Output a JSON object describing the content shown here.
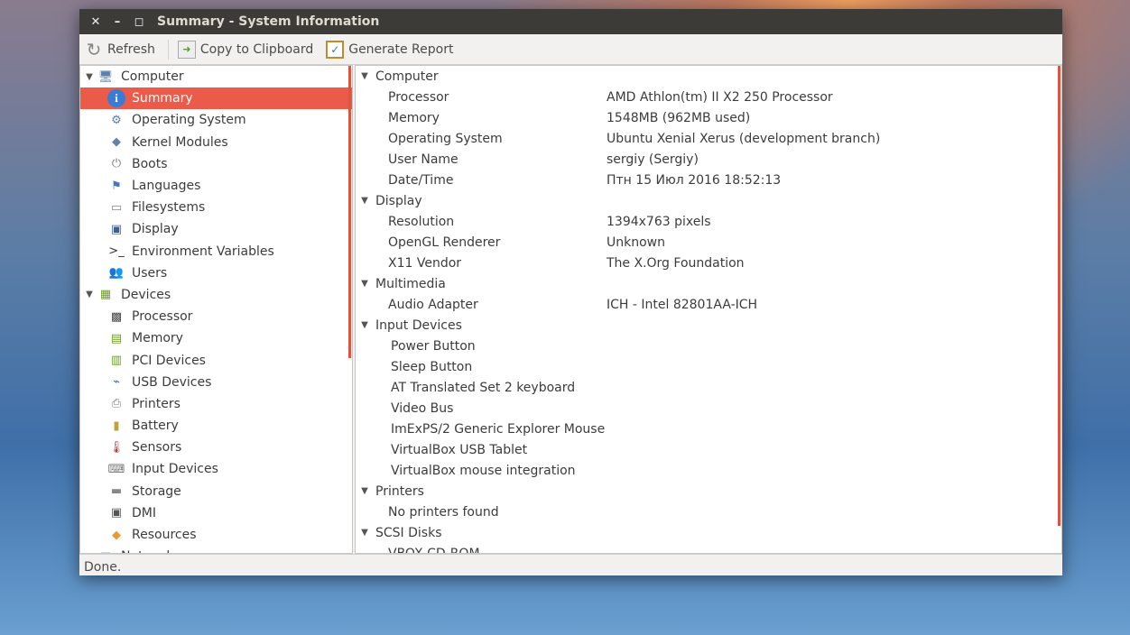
{
  "window": {
    "title": "Summary - System Information",
    "close": "✕",
    "minimize": "–",
    "maximize": "▫"
  },
  "toolbar": {
    "refresh": "Refresh",
    "copy": "Copy to Clipboard",
    "report": "Generate Report"
  },
  "tree": [
    {
      "label": "Computer",
      "level": 0,
      "icon": "computer-icon",
      "glyph": "🖥",
      "color": "#5a7fb0"
    },
    {
      "label": "Summary",
      "level": 1,
      "icon": "info-icon",
      "glyph": "i",
      "color": "#3a7bd5",
      "selected": true
    },
    {
      "label": "Operating System",
      "level": 1,
      "icon": "gear-icon",
      "glyph": "⚙",
      "color": "#5a7fb0"
    },
    {
      "label": "Kernel Modules",
      "level": 1,
      "icon": "module-icon",
      "glyph": "◆",
      "color": "#6a7fb0"
    },
    {
      "label": "Boots",
      "level": 1,
      "icon": "power-icon",
      "glyph": "⏻",
      "color": "#777"
    },
    {
      "label": "Languages",
      "level": 1,
      "icon": "flag-icon",
      "glyph": "⚑",
      "color": "#4a78c0"
    },
    {
      "label": "Filesystems",
      "level": 1,
      "icon": "drive-icon",
      "glyph": "▭",
      "color": "#888"
    },
    {
      "label": "Display",
      "level": 1,
      "icon": "monitor-icon",
      "glyph": "▣",
      "color": "#3a5f90"
    },
    {
      "label": "Environment Variables",
      "level": 1,
      "icon": "terminal-icon",
      "glyph": ">_",
      "color": "#333"
    },
    {
      "label": "Users",
      "level": 1,
      "icon": "users-icon",
      "glyph": "👥",
      "color": "#d08a30"
    },
    {
      "label": "Devices",
      "level": 0,
      "icon": "devices-icon",
      "glyph": "▦",
      "color": "#6aa020"
    },
    {
      "label": "Processor",
      "level": 1,
      "icon": "cpu-icon",
      "glyph": "▩",
      "color": "#444"
    },
    {
      "label": "Memory",
      "level": 1,
      "icon": "memory-icon",
      "glyph": "▤",
      "color": "#6aa020"
    },
    {
      "label": "PCI Devices",
      "level": 1,
      "icon": "pci-icon",
      "glyph": "▥",
      "color": "#6aa020"
    },
    {
      "label": "USB Devices",
      "level": 1,
      "icon": "usb-icon",
      "glyph": "⌁",
      "color": "#3a6fb0"
    },
    {
      "label": "Printers",
      "level": 1,
      "icon": "printer-icon",
      "glyph": "⎙",
      "color": "#777"
    },
    {
      "label": "Battery",
      "level": 1,
      "icon": "battery-icon",
      "glyph": "▮",
      "color": "#c0a040"
    },
    {
      "label": "Sensors",
      "level": 1,
      "icon": "thermometer-icon",
      "glyph": "🌡",
      "color": "#c03030"
    },
    {
      "label": "Input Devices",
      "level": 1,
      "icon": "input-icon",
      "glyph": "⌨",
      "color": "#777"
    },
    {
      "label": "Storage",
      "level": 1,
      "icon": "storage-icon",
      "glyph": "▬",
      "color": "#888"
    },
    {
      "label": "DMI",
      "level": 1,
      "icon": "dmi-icon",
      "glyph": "▣",
      "color": "#555"
    },
    {
      "label": "Resources",
      "level": 1,
      "icon": "resources-icon",
      "glyph": "◆",
      "color": "#e89a30"
    },
    {
      "label": "Network",
      "level": 0,
      "icon": "network-icon",
      "glyph": "▣",
      "color": "#3a5f90"
    }
  ],
  "details": [
    {
      "type": "section",
      "label": "Computer"
    },
    {
      "type": "kv",
      "key": "Processor",
      "value": "AMD Athlon(tm) II X2 250 Processor"
    },
    {
      "type": "kv",
      "key": "Memory",
      "value": "1548MB (962MB used)"
    },
    {
      "type": "kv",
      "key": "Operating System",
      "value": "Ubuntu Xenial Xerus (development branch)"
    },
    {
      "type": "kv",
      "key": "User Name",
      "value": "sergiy (Sergiy)"
    },
    {
      "type": "kv",
      "key": "Date/Time",
      "value": "Птн 15 Июл 2016 18:52:13"
    },
    {
      "type": "section",
      "label": "Display"
    },
    {
      "type": "kv",
      "key": "Resolution",
      "value": "1394x763 pixels"
    },
    {
      "type": "kv",
      "key": "OpenGL Renderer",
      "value": "Unknown"
    },
    {
      "type": "kv",
      "key": "X11 Vendor",
      "value": "The X.Org Foundation"
    },
    {
      "type": "section",
      "label": "Multimedia"
    },
    {
      "type": "kv",
      "key": "Audio Adapter",
      "value": "ICH - Intel 82801AA-ICH"
    },
    {
      "type": "section",
      "label": "Input Devices"
    },
    {
      "type": "item",
      "key": "Power Button"
    },
    {
      "type": "item",
      "key": "Sleep Button"
    },
    {
      "type": "item",
      "key": "AT Translated Set 2 keyboard"
    },
    {
      "type": "item",
      "key": "Video Bus"
    },
    {
      "type": "item",
      "key": "ImExPS/2 Generic Explorer Mouse"
    },
    {
      "type": "item",
      "key": "VirtualBox USB Tablet"
    },
    {
      "type": "item",
      "key": "VirtualBox mouse integration"
    },
    {
      "type": "section",
      "label": "Printers"
    },
    {
      "type": "kv",
      "key": "No printers found",
      "value": ""
    },
    {
      "type": "section",
      "label": "SCSI Disks"
    },
    {
      "type": "kv",
      "key": "VBOX CD-ROM",
      "value": ""
    }
  ],
  "status": "Done.",
  "accent": "#ec5a4a"
}
